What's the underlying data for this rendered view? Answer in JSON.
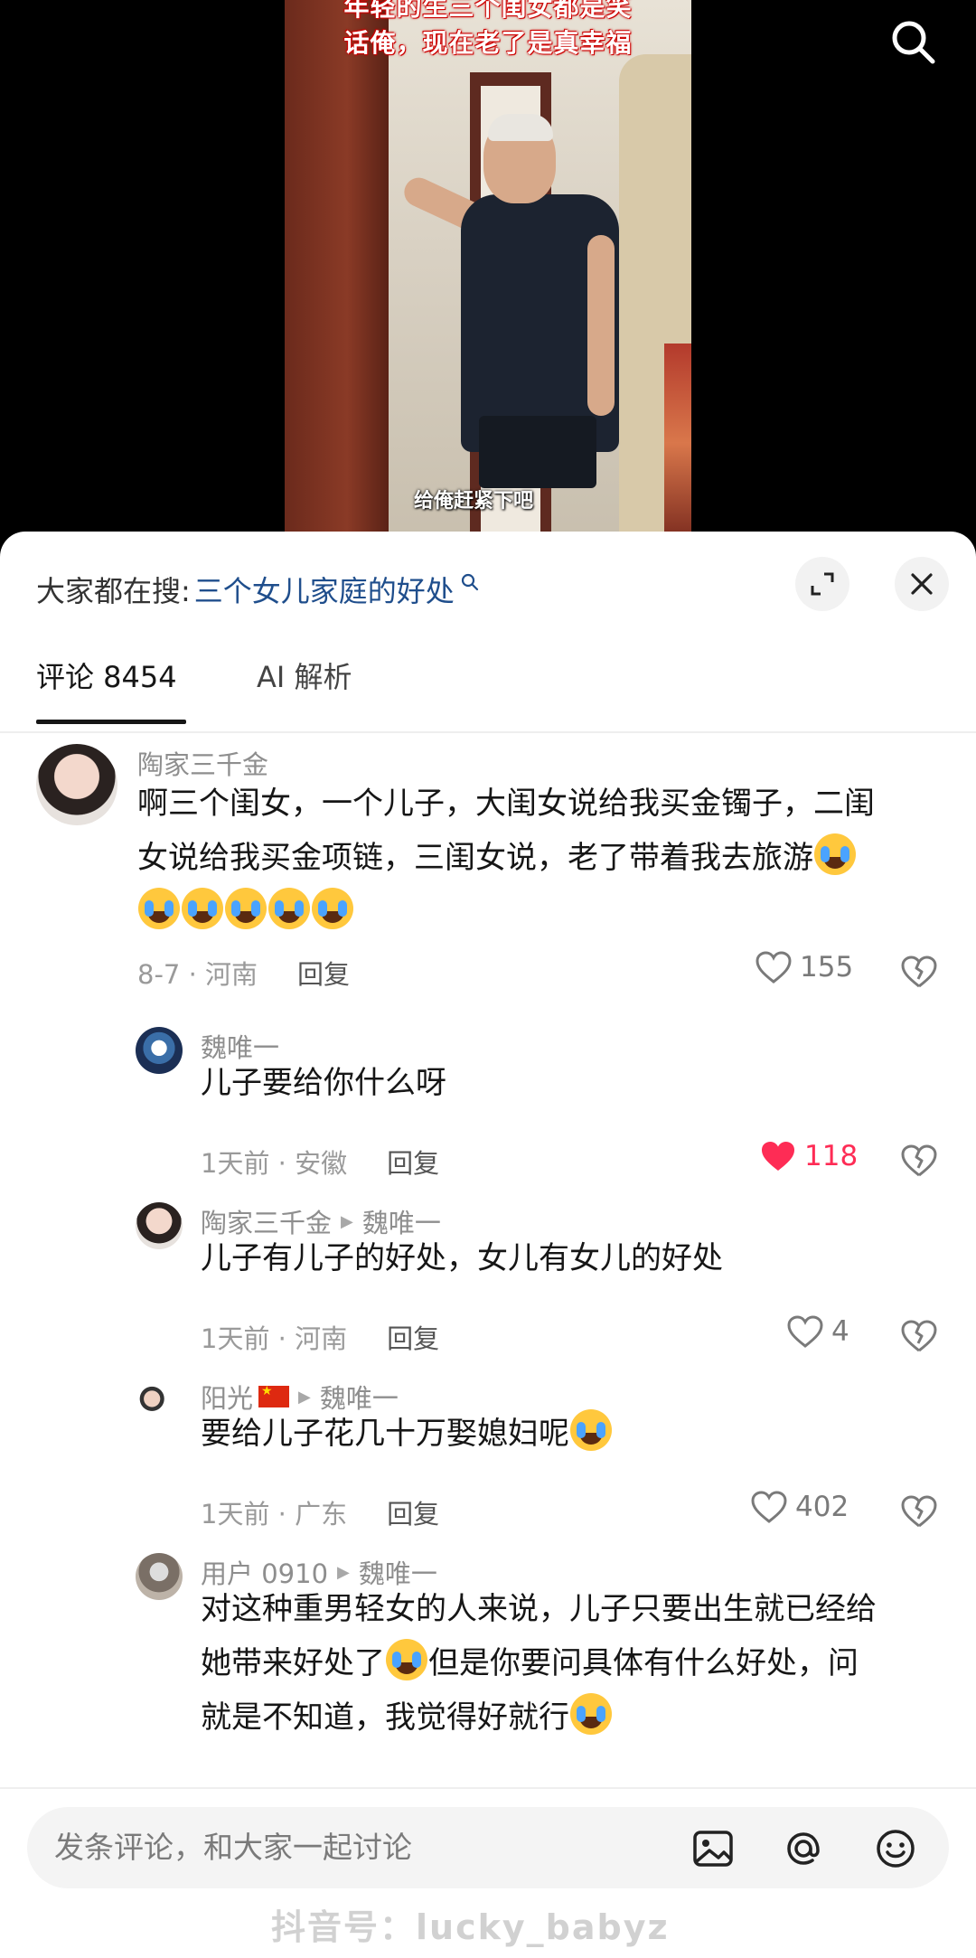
{
  "video": {
    "caption_line1": "年轻的生三个闺女都是笑",
    "caption_line2": "话俺，现在老了是真幸福",
    "subtitle": "给俺赶紧下吧"
  },
  "search_bar": {
    "prefix": "大家都在搜:",
    "query": "三个女儿家庭的好处"
  },
  "tabs": [
    {
      "label": "评论 8454"
    },
    {
      "label": "AI 解析"
    }
  ],
  "comments": [
    {
      "name": "陶家三千金",
      "text_line1": "啊三个闺女，一个儿子，大闺女说给我买金镯子，二闺",
      "text_line2": "女说给我买金项链，三闺女说，老了带着我去旅游",
      "meta": "8-7 · 河南",
      "reply": "回复",
      "likes": "155",
      "liked": false
    },
    {
      "name": "魏唯一",
      "text": "儿子要给你什么呀",
      "meta": "1天前 · 安徽",
      "reply": "回复",
      "likes": "118",
      "liked": true
    },
    {
      "name": "陶家三千金",
      "reply_to": "魏唯一",
      "text": "儿子有儿子的好处，女儿有女儿的好处",
      "meta": "1天前 · 河南",
      "reply": "回复",
      "likes": "4",
      "liked": false
    },
    {
      "name": "阳光",
      "reply_to": "魏唯一",
      "text": "要给儿子花几十万娶媳妇呢",
      "meta": "1天前 · 广东",
      "reply": "回复",
      "likes": "402",
      "liked": false
    },
    {
      "name": "用户 0910",
      "reply_to": "魏唯一",
      "text_line1": "对这种重男轻女的人来说，儿子只要出生就已经给",
      "text_line2": "她带来好处了",
      "text_line2b": "但是你要问具体有什么好处，问",
      "text_line3": "就是不知道，我觉得好就行"
    }
  ],
  "input": {
    "placeholder": "发条评论，和大家一起讨论"
  },
  "watermark": "抖音号：lucky_babyz",
  "colors": {
    "accent_red": "#fe2c55",
    "search_query_blue": "#1f4e8c"
  }
}
